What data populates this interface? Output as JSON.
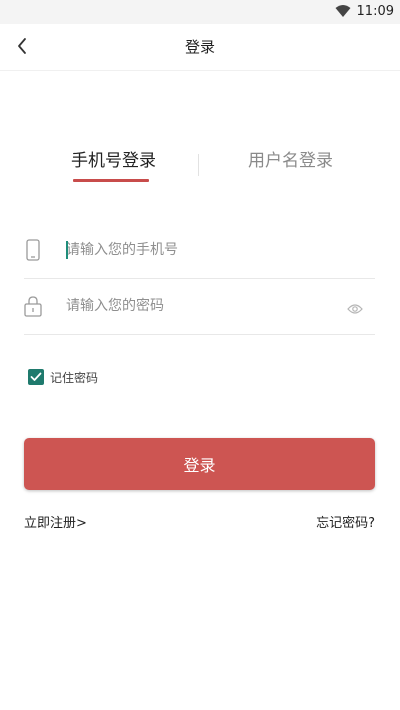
{
  "status_bar": {
    "time": "11:09"
  },
  "header": {
    "title": "登录"
  },
  "tabs": [
    {
      "label": "手机号登录",
      "active": true
    },
    {
      "label": "用户名登录",
      "active": false
    }
  ],
  "form": {
    "phone_placeholder": "请输入您的手机号",
    "password_placeholder": "请输入您的密码",
    "remember_label": "记住密码",
    "remember_checked": true,
    "submit_label": "登录"
  },
  "links": {
    "register": "立即注册>",
    "forgot": "忘记密码?"
  },
  "colors": {
    "accent": "#cd5552",
    "checkbox": "#1f7a6d"
  }
}
